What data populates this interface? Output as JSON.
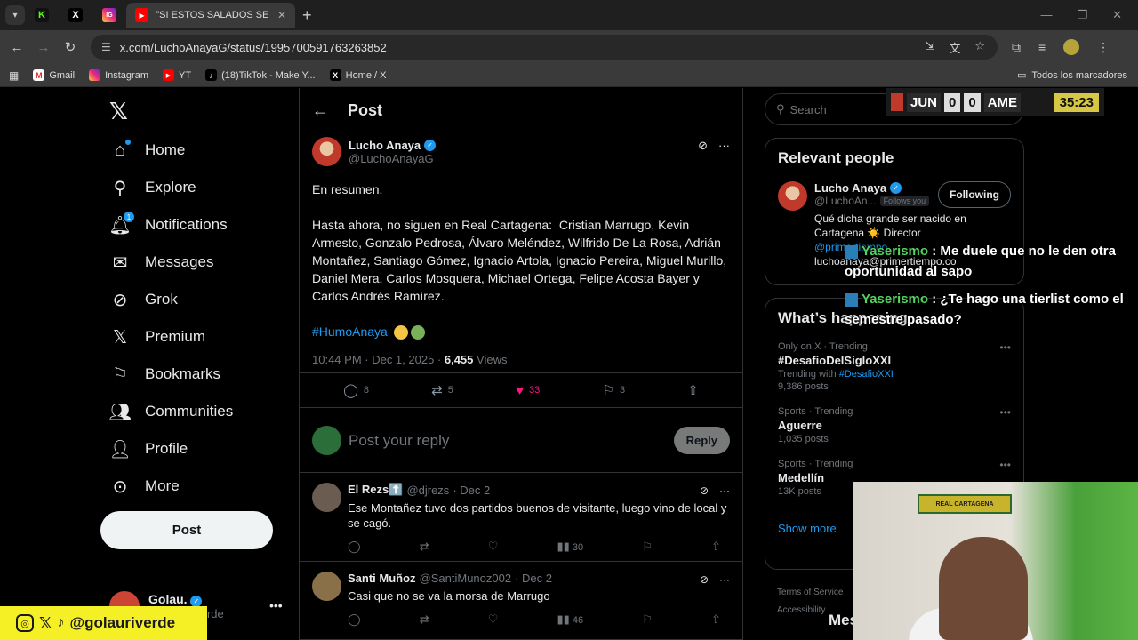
{
  "browser": {
    "tabs": [
      {
        "label": "K"
      },
      {
        "label": "X"
      },
      {
        "label": "IG"
      },
      {
        "label": "\"SI ESTOS SALADOS SE VAN, ES"
      }
    ],
    "url": "x.com/LuchoAnayaG/status/1995700591763263852",
    "bookmarks": [
      "Gmail",
      "Instagram",
      "YT",
      "(18)TikTok - Make Y...",
      "Home / X"
    ],
    "all_bookmarks": "Todos los marcadores"
  },
  "nav": {
    "items": [
      {
        "label": "Home",
        "icon": "home-icon"
      },
      {
        "label": "Explore",
        "icon": "search-icon"
      },
      {
        "label": "Notifications",
        "icon": "bell-icon",
        "badge": "1"
      },
      {
        "label": "Messages",
        "icon": "mail-icon"
      },
      {
        "label": "Grok",
        "icon": "grok-icon"
      },
      {
        "label": "Premium",
        "icon": "x-icon"
      },
      {
        "label": "Bookmarks",
        "icon": "bookmark-icon"
      },
      {
        "label": "Communities",
        "icon": "communities-icon"
      },
      {
        "label": "Profile",
        "icon": "profile-icon"
      },
      {
        "label": "More",
        "icon": "more-icon"
      }
    ],
    "post_button": "Post",
    "account": {
      "name": "Golau.",
      "handle": "@golauriverde"
    }
  },
  "header": {
    "title": "Post"
  },
  "tweet": {
    "author": "Lucho Anaya",
    "handle": "@LuchoAnayaG",
    "line1": "En resumen.",
    "line2": "Hasta ahora, no siguen en Real Cartagena:  Cristian Marrugo, Kevin Armesto, Gonzalo Pedrosa, Álvaro Meléndez, Wilfrido De La Rosa, Adrián Montañez, Santiago Gómez, Ignacio Artola, Ignacio Pereira, Miguel Murillo, Daniel Mera, Carlos Mosquera, Michael Ortega, Felipe Acosta Bayer y Carlos Andrés Ramírez.",
    "hashtag": "#HumoAnaya",
    "time": "10:44 PM · Dec 1, 2025 · ",
    "views_count": "6,455",
    "views_label": " Views",
    "stats": {
      "replies": "8",
      "reposts": "5",
      "likes": "33",
      "bookmarks": "3"
    }
  },
  "reply_box": {
    "placeholder": "Post your reply",
    "button": "Reply"
  },
  "replies": [
    {
      "name": "El Rezs⬆️",
      "handle": "@djrezs",
      "date": "· Dec 2",
      "text": "Ese Montañez tuvo dos partidos buenos de visitante, luego vino de local y se cagó.",
      "views": "30"
    },
    {
      "name": "Santi Muñoz",
      "handle": "@SantiMunoz002",
      "date": "· Dec 2",
      "text": "Casi que no se va la morsa de Marrugo",
      "views": "46"
    }
  ],
  "sidebar": {
    "search_placeholder": "Search",
    "relevant_title": "Relevant people",
    "person": {
      "name": "Lucho Anaya",
      "handle": "@LuchoAn...",
      "follows_you": "Follows you",
      "follow_button": "Following",
      "bio1": "Qué dicha grande ser nacido en Cartagena ☀️ Director",
      "bio_mention": "@primertiempo",
      "bio2": "luchoanaya@primertiempo.co"
    },
    "happening_title": "What’s happening",
    "trends": [
      {
        "label": "Only on X · Trending",
        "name": "#DesafioDelSigloXXI",
        "with_label": "Trending with ",
        "with_tag": "#DesafioXXI",
        "posts": "9,386 posts"
      },
      {
        "label": "Sports · Trending",
        "name": "Aguerre",
        "posts": "1,035 posts"
      },
      {
        "label": "Sports · Trending",
        "name": "Medellín",
        "posts": "13K posts"
      }
    ],
    "show_more": "Show more",
    "footer1": "Terms of Service",
    "footer2": "Accessibility"
  },
  "overlay": {
    "score_home": "JUN",
    "score_a": "0",
    "score_b": "0",
    "score_away": "AME",
    "clock": "35:23",
    "chat": [
      {
        "user": "Yaserismo",
        "text": " : Me duele que no le den otra oportunidad al sapo"
      },
      {
        "user": "Yaserismo",
        "text": " : ¿Te hago una tierlist como el semestre pasado?"
      }
    ],
    "social_handle": "@golauriverde",
    "webcam_banner": "REAL CARTAGENA",
    "messages_partial": "Mes"
  }
}
